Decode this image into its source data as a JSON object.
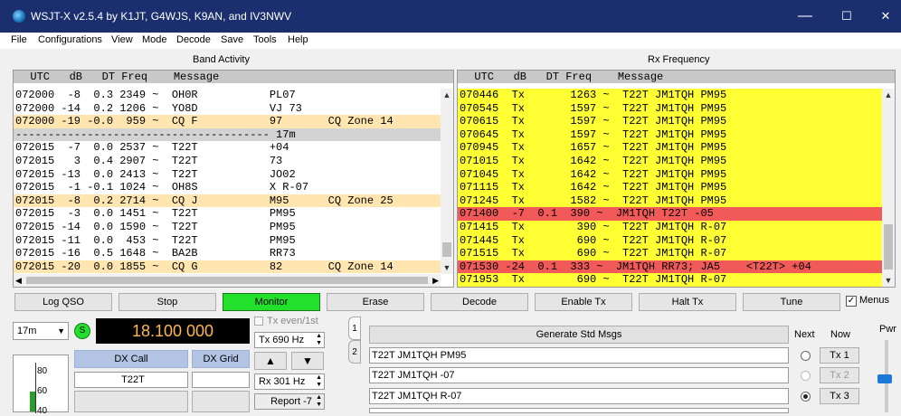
{
  "window": {
    "title": "WSJT-X   v2.5.4   by K1JT, G4WJS, K9AN, and IV3NWV",
    "minimize": "—",
    "maximize": "☐",
    "close": "✕"
  },
  "menu": [
    "File",
    "Configurations",
    "View",
    "Mode",
    "Decode",
    "Save",
    "Tools",
    "Help"
  ],
  "band_activity": {
    "title": "Band Activity",
    "header": "  UTC   dB   DT Freq    Message",
    "rows": [
      {
        "text": "072000  -8  0.3 2349 ~  OH0R           PL07",
        "bg": "#ffffff"
      },
      {
        "text": "072000 -14  0.2 1206 ~  YO8D           VJ 73",
        "bg": "#ffffff"
      },
      {
        "text": "072000 -19 -0.0  959 ~  CQ F           97       CQ Zone 14",
        "bg": "#ffe6b0"
      },
      {
        "text": "--------------------------------------- 17m",
        "bg": "#d3d3d3"
      },
      {
        "text": "072015  -7  0.0 2537 ~  T22T           +04",
        "bg": "#ffffff"
      },
      {
        "text": "072015   3  0.4 2907 ~  T22T           73",
        "bg": "#ffffff"
      },
      {
        "text": "072015 -13  0.0 2413 ~  T22T           JO02",
        "bg": "#ffffff"
      },
      {
        "text": "072015  -1 -0.1 1024 ~  OH8S           X R-07",
        "bg": "#ffffff"
      },
      {
        "text": "072015  -8  0.2 2714 ~  CQ J           M95      CQ Zone 25",
        "bg": "#ffe6b0"
      },
      {
        "text": "072015  -3  0.0 1451 ~  T22T           PM95",
        "bg": "#ffffff"
      },
      {
        "text": "072015 -14  0.0 1590 ~  T22T           PM95",
        "bg": "#ffffff"
      },
      {
        "text": "072015 -11  0.0  453 ~  T22T           PM95",
        "bg": "#ffffff"
      },
      {
        "text": "072015 -16  0.5 1648 ~  BA2B           RR73",
        "bg": "#ffffff"
      },
      {
        "text": "072015 -20  0.0 1855 ~  CQ G           82       CQ Zone 14",
        "bg": "#ffe6b0"
      }
    ]
  },
  "rx_frequency": {
    "title": "Rx Frequency",
    "header": "  UTC   dB   DT Freq    Message",
    "rows": [
      {
        "text": "070446  Tx       1263 ~  T22T JM1TQH PM95",
        "bg": "#ffff33"
      },
      {
        "text": "070545  Tx       1597 ~  T22T JM1TQH PM95",
        "bg": "#ffff33"
      },
      {
        "text": "070615  Tx       1597 ~  T22T JM1TQH PM95",
        "bg": "#ffff33"
      },
      {
        "text": "070645  Tx       1597 ~  T22T JM1TQH PM95",
        "bg": "#ffff33"
      },
      {
        "text": "070945  Tx       1657 ~  T22T JM1TQH PM95",
        "bg": "#ffff33"
      },
      {
        "text": "071015  Tx       1642 ~  T22T JM1TQH PM95",
        "bg": "#ffff33"
      },
      {
        "text": "071045  Tx       1642 ~  T22T JM1TQH PM95",
        "bg": "#ffff33"
      },
      {
        "text": "071115  Tx       1642 ~  T22T JM1TQH PM95",
        "bg": "#ffff33"
      },
      {
        "text": "071245  Tx       1582 ~  T22T JM1TQH PM95",
        "bg": "#ffff33"
      },
      {
        "text": "071400  -7  0.1  390 ~  JM1TQH T22T -05",
        "bg": "#f25a5a"
      },
      {
        "text": "071415  Tx        390 ~  T22T JM1TQH R-07",
        "bg": "#ffff33"
      },
      {
        "text": "071445  Tx        690 ~  T22T JM1TQH R-07",
        "bg": "#ffff33"
      },
      {
        "text": "071515  Tx        690 ~  T22T JM1TQH R-07",
        "bg": "#ffff33"
      },
      {
        "text": "071530 -24  0.1  333 ~  JM1TQH RR73; JA5    <T22T> +04",
        "bg": "#f25a5a"
      },
      {
        "text": "071953  Tx        690 ~  T22T JM1TQH R-07",
        "bg": "#ffff33"
      }
    ]
  },
  "buttons": {
    "log_qso": "Log QSO",
    "stop": "Stop",
    "monitor": "Monitor",
    "erase": "Erase",
    "decode": "Decode",
    "enable_tx": "Enable Tx",
    "halt_tx": "Halt Tx",
    "tune": "Tune",
    "menus": "Menus"
  },
  "band": {
    "selected": "17m",
    "s_indicator": "S",
    "frequency": "18.100 000"
  },
  "tx_even": "Tx even/1st",
  "tx_freq": "Tx  690  Hz",
  "rx_freq": "Rx  301  Hz",
  "report": "Report -7",
  "dx": {
    "call_label": "DX Call",
    "grid_label": "DX Grid",
    "call_value": "T22T",
    "grid_value": ""
  },
  "signal_meter": {
    "ticks": [
      "80",
      "60",
      "40"
    ],
    "level": 0.35
  },
  "tabs": [
    "1",
    "2"
  ],
  "std_msgs": {
    "generate": "Generate Std Msgs",
    "next_label": "Next",
    "now_label": "Now",
    "messages": [
      "T22T JM1TQH PM95",
      "T22T JM1TQH -07",
      "T22T JM1TQH R-07"
    ],
    "tx_buttons": [
      "Tx 1",
      "Tx 2",
      "Tx 3"
    ]
  },
  "pwr_label": "Pwr"
}
